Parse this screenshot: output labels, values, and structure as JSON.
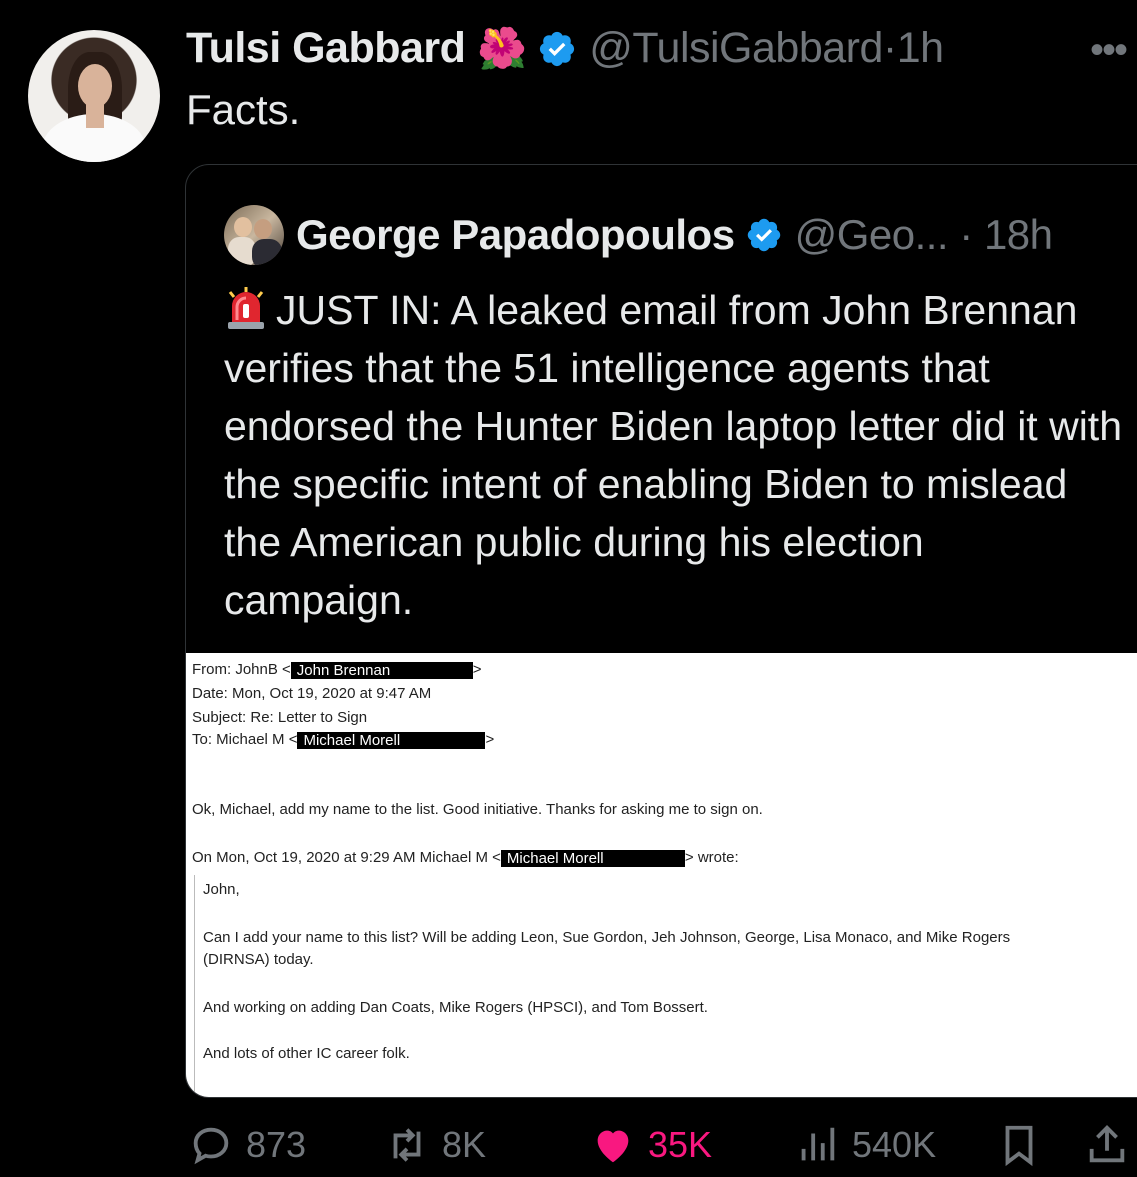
{
  "tweet": {
    "author_name": "Tulsi Gabbard",
    "name_emoji": "🌺",
    "handle": "@TulsiGabbard",
    "separator": "·",
    "time": "1h",
    "text": "Facts.",
    "more_icon": "more-icon"
  },
  "quote": {
    "author_name": "George Papadopoulos",
    "handle": "@Geo...",
    "separator": "·",
    "time": "18h",
    "text": "JUST IN: A leaked email from John Brennan verifies that the 51 intelligence agents that endorsed the Hunter Biden laptop letter did it with the specific intent of enabling Biden to mislead the American public during his election campaign.",
    "text_icon": "siren-icon"
  },
  "email": {
    "from_label": "From: JohnB <",
    "from_redacted": "John Brennan",
    "from_close": ">",
    "date_line": "Date: Mon, Oct 19, 2020 at 9:47 AM",
    "subject_line": "Subject: Re: Letter to Sign",
    "to_label": "To: Michael M <",
    "to_redacted": "Michael Morell",
    "to_close": ">",
    "reply_text": "Ok, Michael, add my name to the list.  Good initiative.  Thanks for asking me to sign on.",
    "on_label": "On Mon, Oct 19, 2020 at 9:29 AM Michael M <",
    "on_redacted": "Michael Morell",
    "on_close": "> wrote:",
    "quoted_greeting": "John,",
    "quoted_p1_line1": "Can I add your name to this list?  Will be adding Leon, Sue Gordon, Jeh Johnson, George, Lisa Monaco, and Mike Rogers",
    "quoted_p1_line2": "(DIRNSA) today.",
    "quoted_p2": "And working on adding Dan Coats, Mike Rogers (HPSCI), and Tom Bossert.",
    "quoted_p3": "And lots of other IC career folk."
  },
  "actions": {
    "replies": "873",
    "reposts": "8K",
    "likes": "35K",
    "views": "540K",
    "like_color": "#f91880",
    "muted_color": "#71767b",
    "verified_color": "#1d9bf0"
  }
}
